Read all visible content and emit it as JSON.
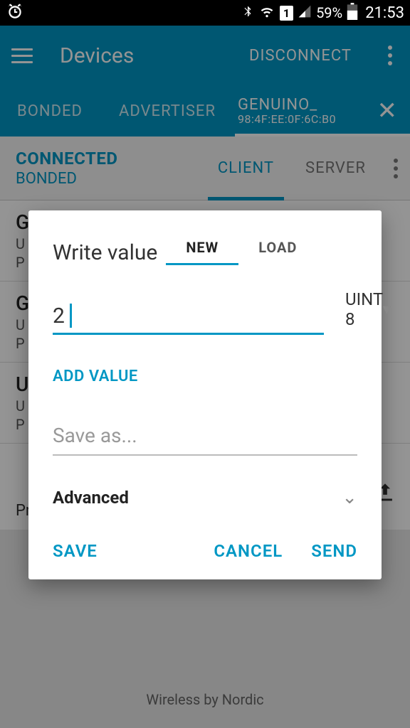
{
  "status": {
    "battery_pct": "59%",
    "time": "21:53",
    "sim": "1"
  },
  "appbar": {
    "title": "Devices",
    "disconnect": "DISCONNECT",
    "tabs": {
      "bonded": "BONDED",
      "advertiser": "ADVERTISER",
      "device_name": "GENUINO_",
      "device_mac": "98:4F:EE:0F:6C:B0"
    }
  },
  "subheader": {
    "line1": "CONNECTED",
    "line2": "BONDED",
    "client": "CLIENT",
    "server": "SERVER"
  },
  "list": {
    "item0": {
      "title": "G",
      "uuid": "U",
      "props": "P"
    },
    "item1": {
      "title": "G",
      "uuid": "U",
      "props": "P"
    },
    "item2": {
      "title": "U",
      "uuid": "U",
      "props": "P"
    },
    "item3_props": "Properties: READ, WRITE"
  },
  "dialog": {
    "title": "Write value",
    "tab_new": "NEW",
    "tab_load": "LOAD",
    "value": "2",
    "type": "UINT 8",
    "add_value": "ADD VALUE",
    "save_as_placeholder": "Save as...",
    "advanced": "Advanced",
    "save": "SAVE",
    "cancel": "CANCEL",
    "send": "SEND"
  },
  "footer": "Wireless by Nordic"
}
